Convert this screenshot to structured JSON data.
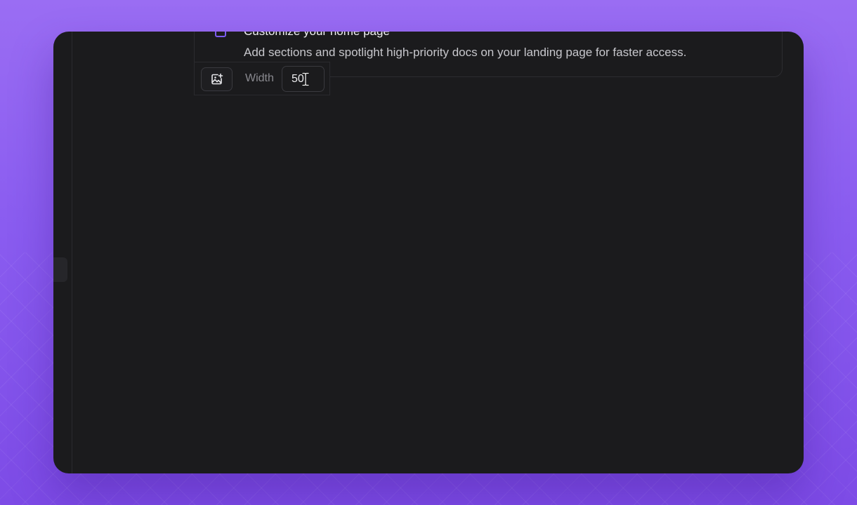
{
  "checklist_item": {
    "title": "Customize your home page",
    "description": "Add sections and spotlight high-priority docs on your landing page for faster access.",
    "checked": false
  },
  "image_toolbar": {
    "add_image_icon": "image-plus-icon",
    "width_label": "Width",
    "width_value": "50"
  },
  "colors": {
    "accent": "#7c5cf0",
    "window_bg": "#1b1b1d",
    "backdrop": "#8a5cf0"
  }
}
